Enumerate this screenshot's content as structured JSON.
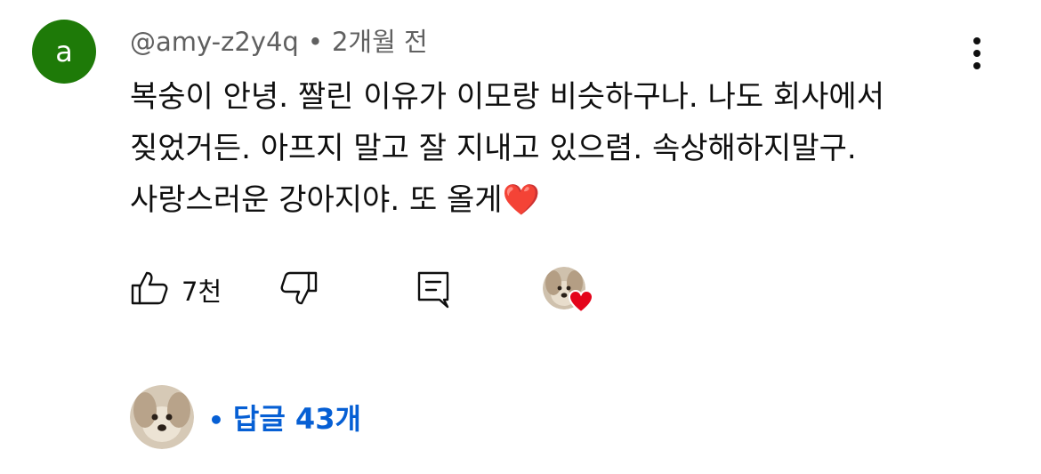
{
  "comment": {
    "author_initial": "a",
    "author_handle": "@amy-z2y4q",
    "separator": "•",
    "time_ago": "2개월 전",
    "text": "복숭이 안녕. 짤린 이유가 이모랑 비슷하구나. 나도 회사에서 짖었거든. 아프지 말고 잘 지내고 있으렴. 속상해하지말구. 사랑스러운 강아지야. 또 올게",
    "emoji": "❤️"
  },
  "actions": {
    "like_count": "7천"
  },
  "replies": {
    "separator": "•",
    "label": "답글 43개"
  },
  "colors": {
    "avatar_bg": "#1e7a08",
    "link_blue": "#065fd4",
    "meta_gray": "#606060",
    "heart_red": "#e4041b"
  },
  "icons": {
    "more": "more-vert-icon",
    "like": "thumb-up-icon",
    "dislike": "thumb-down-icon",
    "reply": "comment-icon",
    "creator_heart": "creator-heart-icon"
  }
}
